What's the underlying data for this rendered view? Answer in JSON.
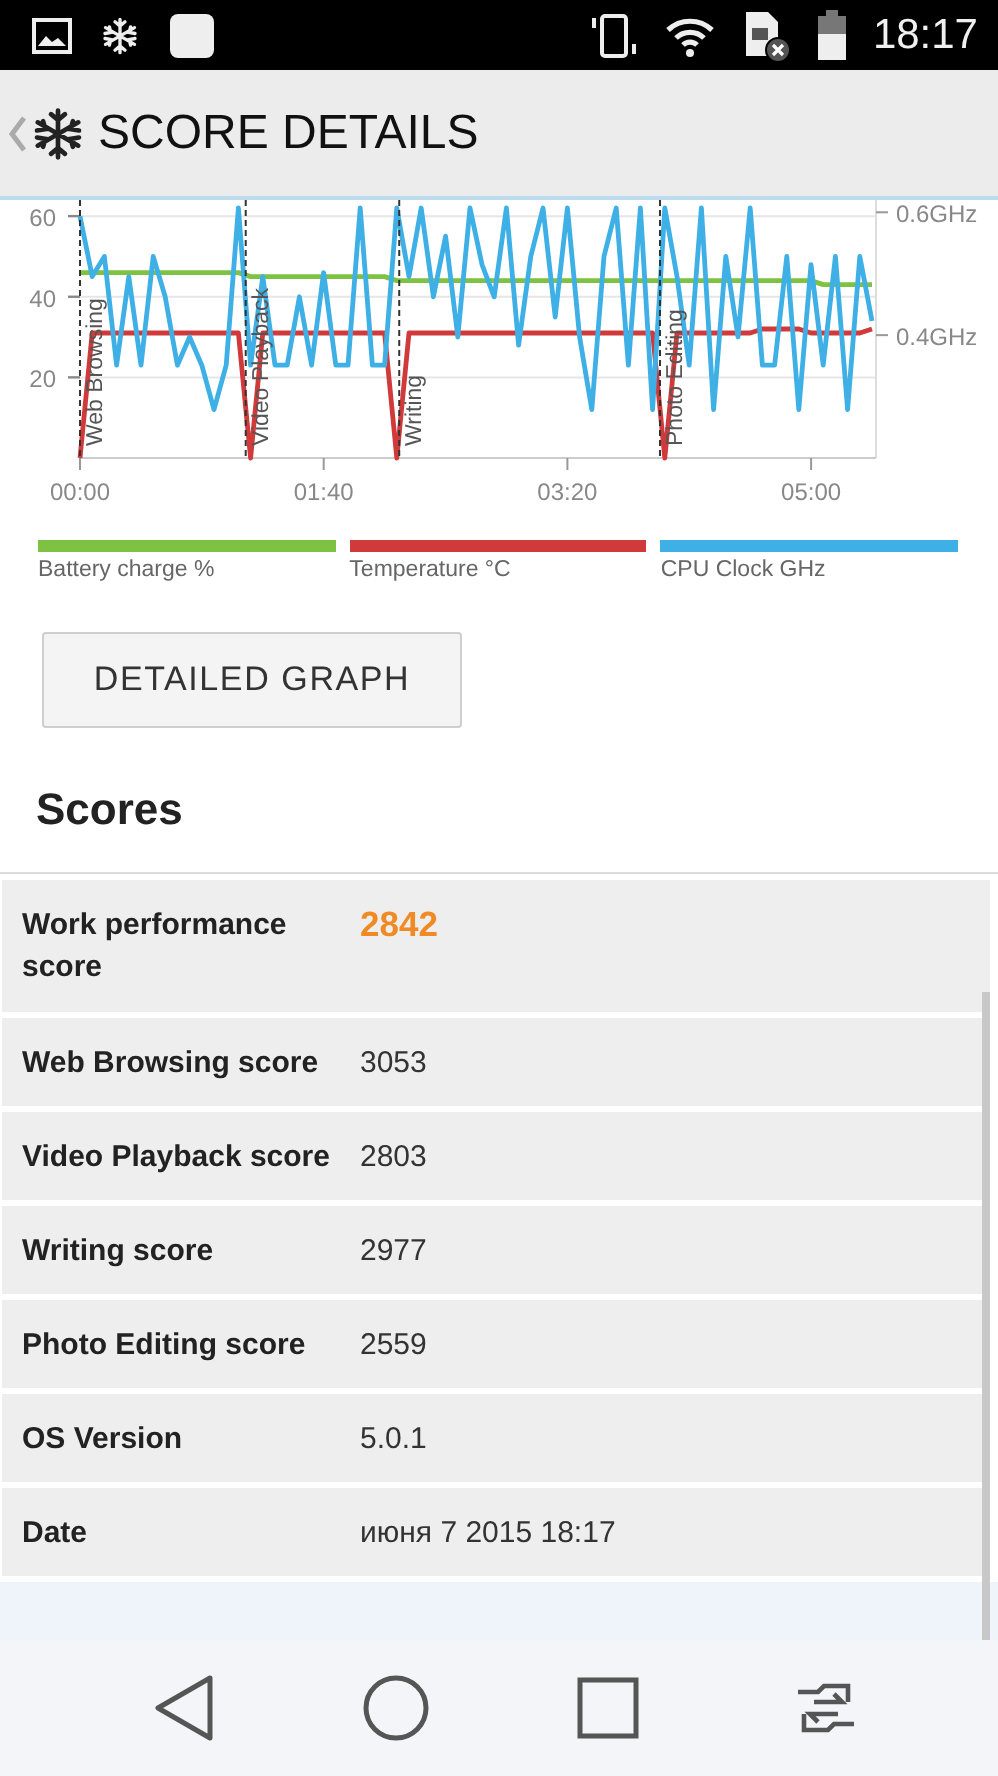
{
  "status_bar": {
    "time": "18:17"
  },
  "app_bar": {
    "title": "SCORE DETAILS"
  },
  "chart": {
    "chart_data": {
      "type": "line",
      "x": [
        0,
        5,
        10,
        15,
        20,
        25,
        30,
        35,
        40,
        45,
        50,
        55,
        60,
        65,
        70,
        75,
        80,
        85,
        90,
        95,
        100,
        105,
        110,
        115,
        120,
        125,
        130,
        135,
        140,
        145,
        150,
        155,
        160,
        165,
        170,
        175,
        180,
        185,
        190,
        195,
        200,
        205,
        210,
        215,
        220,
        225,
        230,
        235,
        240,
        245,
        250,
        255,
        260,
        265,
        270,
        275,
        280,
        285,
        290,
        295,
        300,
        305,
        310,
        315,
        320,
        325
      ],
      "xlim": [
        0,
        325
      ],
      "ylim": [
        0,
        64
      ],
      "grid": true,
      "y2lim": [
        0.2,
        0.62
      ],
      "xticks": [
        {
          "value": 0,
          "label": "00:00"
        },
        {
          "value": 100,
          "label": "01:40"
        },
        {
          "value": 200,
          "label": "03:20"
        },
        {
          "value": 300,
          "label": "05:00"
        }
      ],
      "yticks": [
        20,
        40,
        60
      ],
      "y2ticks": [
        {
          "value": 0.4,
          "label": "0.4GHz"
        },
        {
          "value": 0.6,
          "label": "0.6GHz"
        }
      ],
      "series": [
        {
          "name": "Battery charge %",
          "color": "#7dc242",
          "values": [
            46,
            46,
            46,
            46,
            46,
            46,
            46,
            46,
            46,
            46,
            46,
            46,
            46,
            46,
            45,
            45,
            45,
            45,
            45,
            45,
            45,
            45,
            45,
            45,
            45,
            45,
            44,
            44,
            44,
            44,
            44,
            44,
            44,
            44,
            44,
            44,
            44,
            44,
            44,
            44,
            44,
            44,
            44,
            44,
            44,
            44,
            44,
            44,
            44,
            44,
            44,
            44,
            44,
            44,
            44,
            44,
            44,
            44,
            44,
            44,
            44,
            43,
            43,
            43,
            43,
            43
          ]
        },
        {
          "name": "Temperature °C",
          "color": "#d13a3a",
          "values": [
            0,
            31,
            31,
            31,
            31,
            31,
            31,
            31,
            31,
            31,
            31,
            31,
            31,
            31,
            0,
            31,
            31,
            31,
            31,
            31,
            31,
            31,
            31,
            31,
            31,
            31,
            0,
            31,
            31,
            31,
            31,
            31,
            31,
            31,
            31,
            31,
            31,
            31,
            31,
            31,
            31,
            31,
            31,
            31,
            31,
            31,
            31,
            31,
            0,
            31,
            31,
            31,
            31,
            31,
            31,
            31,
            32,
            32,
            32,
            32,
            31,
            31,
            31,
            31,
            31,
            32
          ]
        },
        {
          "name": "CPU Clock GHz",
          "color": "#3fb0e6",
          "values": [
            60,
            45,
            50,
            23,
            45,
            23,
            50,
            40,
            23,
            30,
            23,
            12,
            23,
            62,
            23,
            45,
            23,
            23,
            40,
            23,
            46,
            23,
            23,
            62,
            23,
            23,
            62,
            45,
            62,
            40,
            55,
            30,
            62,
            48,
            40,
            62,
            28,
            50,
            62,
            35,
            62,
            30,
            12,
            50,
            62,
            23,
            62,
            12,
            62,
            45,
            23,
            62,
            12,
            50,
            30,
            62,
            23,
            23,
            50,
            12,
            48,
            23,
            50,
            12,
            50,
            34
          ]
        }
      ],
      "annotations": [
        {
          "x": 0,
          "text": "Web Browsing"
        },
        {
          "x": 68,
          "text": "Video Playback"
        },
        {
          "x": 131,
          "text": "Writing"
        },
        {
          "x": 238,
          "text": "Photo Editing"
        }
      ]
    }
  },
  "button": "DETAILED GRAPH",
  "scores": {
    "heading": "Scores",
    "rows": [
      {
        "label": "Work performance score",
        "value": "2842",
        "highlight": true
      },
      {
        "label": "Web Browsing score",
        "value": "3053",
        "highlight": false
      },
      {
        "label": "Video Playback score",
        "value": "2803",
        "highlight": false
      },
      {
        "label": "Writing score",
        "value": "2977",
        "highlight": false
      },
      {
        "label": "Photo Editing score",
        "value": "2559",
        "highlight": false
      },
      {
        "label": "OS Version",
        "value": "5.0.1",
        "highlight": false
      },
      {
        "label": "Date",
        "value": "июня 7 2015 18:17",
        "highlight": false
      }
    ]
  }
}
